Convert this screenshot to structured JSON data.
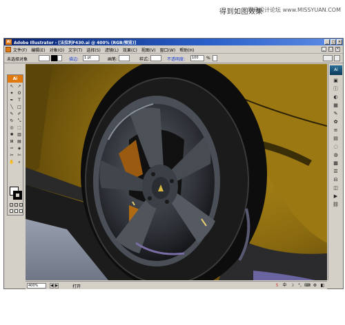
{
  "caption": "得到如图效果",
  "watermark": "思缘设计论坛 www.MISSYUAN.COM",
  "window": {
    "app_name": "Adobe Illustrator",
    "title": "Adobe Illustrator - [法拉利F430.ai @ 400% (RGB/预览)]",
    "controls": [
      "_",
      "□",
      "×"
    ]
  },
  "menu": {
    "items": [
      "文件(F)",
      "编辑(E)",
      "对象(O)",
      "文字(T)",
      "选择(S)",
      "滤镜(L)",
      "效果(C)",
      "视图(V)",
      "窗口(W)",
      "帮助(H)"
    ],
    "doc_controls": [
      "_",
      "□",
      "×"
    ]
  },
  "control_bar": {
    "selection_label": "未选择对象",
    "stroke_label": "描边:",
    "stroke_value": "1 pt",
    "style_label": "画笔:",
    "brush_label": "样式:",
    "opacity_label": "不透明度:",
    "opacity_value": "100",
    "opacity_unit": "%"
  },
  "toolbox": {
    "header": "Ai",
    "tools": [
      {
        "icon": "selection-arrow-icon",
        "glyph": "↖"
      },
      {
        "icon": "direct-selection-icon",
        "glyph": "↗"
      },
      {
        "icon": "magic-wand-icon",
        "glyph": "✦"
      },
      {
        "icon": "lasso-icon",
        "glyph": "ʘ"
      },
      {
        "icon": "pen-icon",
        "glyph": "✒"
      },
      {
        "icon": "type-icon",
        "glyph": "T"
      },
      {
        "icon": "line-icon",
        "glyph": "╲"
      },
      {
        "icon": "rectangle-icon",
        "glyph": "□"
      },
      {
        "icon": "paintbrush-icon",
        "glyph": "✎"
      },
      {
        "icon": "pencil-icon",
        "glyph": "✐"
      },
      {
        "icon": "rotate-icon",
        "glyph": "↻"
      },
      {
        "icon": "scale-icon",
        "glyph": "⤡"
      },
      {
        "icon": "warp-icon",
        "glyph": "◎"
      },
      {
        "icon": "free-transform-icon",
        "glyph": "⬚"
      },
      {
        "icon": "symbol-sprayer-icon",
        "glyph": "✺"
      },
      {
        "icon": "graph-icon",
        "glyph": "▥"
      },
      {
        "icon": "mesh-icon",
        "glyph": "⊞"
      },
      {
        "icon": "gradient-icon",
        "glyph": "▤"
      },
      {
        "icon": "eyedropper-icon",
        "glyph": "✑"
      },
      {
        "icon": "blend-icon",
        "glyph": "◈"
      },
      {
        "icon": "slice-icon",
        "glyph": "✂"
      },
      {
        "icon": "scissors-icon",
        "glyph": "✄"
      },
      {
        "icon": "hand-icon",
        "glyph": "✋"
      },
      {
        "icon": "zoom-icon",
        "glyph": "⌕"
      }
    ]
  },
  "status": {
    "zoom": "400%",
    "text": "打开"
  },
  "dock": {
    "logo": "Ai",
    "icons": [
      "navigator-icon",
      "info-icon",
      "color-icon",
      "swatches-icon",
      "brushes-icon",
      "symbols-icon",
      "stroke-icon",
      "gradient-panel-icon",
      "transparency-icon",
      "appearance-icon",
      "graphic-styles-icon",
      "layers-icon",
      "align-icon",
      "pathfinder-icon",
      "actions-icon",
      "links-icon"
    ]
  },
  "colors": {
    "title_gradient_start": "#0a2470",
    "title_gradient_end": "#5f8ee6",
    "ai_orange": "#e07a10",
    "car_body": "#8a6a10",
    "tire": "#1b1b1b",
    "rim": "#3a3d42"
  }
}
